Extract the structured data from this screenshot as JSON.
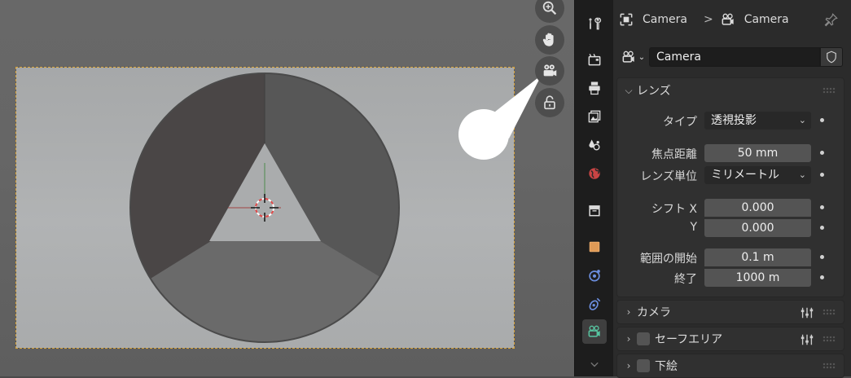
{
  "breadcrumb": {
    "object_name": "Camera",
    "separator": ">",
    "data_name": "Camera"
  },
  "datablock": {
    "name": "Camera"
  },
  "lens_panel": {
    "title": "レンズ",
    "type": {
      "label": "タイプ",
      "value": "透視投影"
    },
    "focal_length": {
      "label": "焦点距離",
      "value": "50 mm"
    },
    "lens_unit": {
      "label": "レンズ単位",
      "value": "ミリメートル"
    },
    "shift_x": {
      "label": "シフト X",
      "value": "0.000"
    },
    "shift_y": {
      "label": "Y",
      "value": "0.000"
    },
    "clip_start": {
      "label": "範囲の開始",
      "value": "0.1 m"
    },
    "clip_end": {
      "label": "終了",
      "value": "1000 m"
    }
  },
  "camera_panel": {
    "title": "カメラ"
  },
  "safe_areas_panel": {
    "title": "セーフエリア"
  },
  "background_panel": {
    "title": "下絵"
  },
  "icons": {
    "viewport_nav": [
      "zoom-icon",
      "hand-icon",
      "camera-view-icon",
      "lock-icon"
    ],
    "toolstrip": [
      "tool-icon",
      "render-icon",
      "output-icon",
      "view-layer-icon",
      "scene-icon",
      "world-icon",
      "collection-icon",
      "object-icon",
      "physics-icon",
      "constraints-icon",
      "camera-data-icon",
      "more-icon"
    ]
  },
  "colors": {
    "frame_border": "#d9a43a",
    "camera_data_accent": "#57c4a0",
    "object_accent": "#e09a56",
    "physics_accent": "#6c8fe0"
  }
}
